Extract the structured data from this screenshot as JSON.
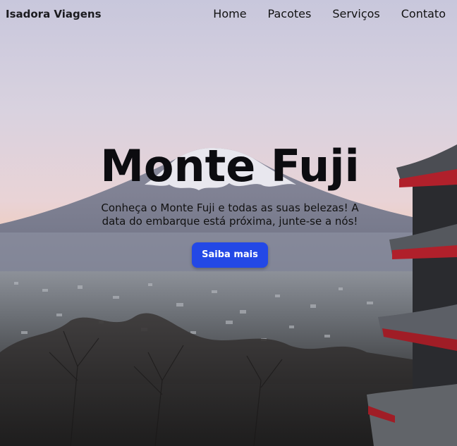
{
  "nav": {
    "brand": "Isadora Viagens",
    "links": [
      "Home",
      "Pacotes",
      "Serviços",
      "Contato"
    ]
  },
  "hero": {
    "title": "Monte Fuji",
    "description": "Conheça o Monte Fuji e todas as suas belezas! A data do embarque está próxima, junte-se a nós!",
    "button": "Saiba mais"
  },
  "colors": {
    "button": "#2348e6",
    "text": "#111111"
  }
}
